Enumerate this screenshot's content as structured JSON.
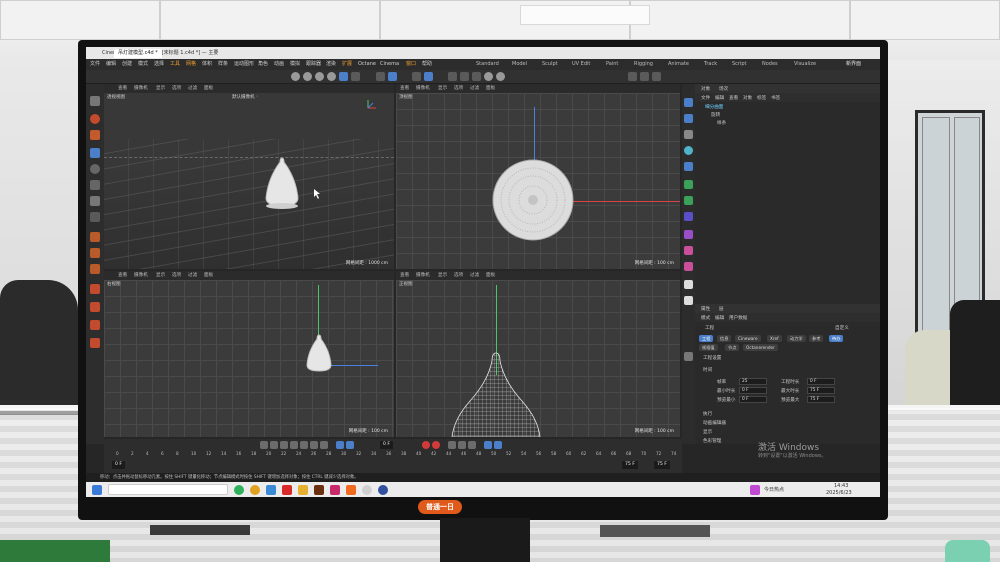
{
  "app": {
    "title": "Cinema 4D 2023.2.2 — [未标题 1.c4d *] — 主要",
    "file_tab": "吊灯建模型.c4d *",
    "menus": [
      "文件",
      "编辑",
      "创建",
      "模式",
      "选择",
      "工具",
      "网格",
      "体积",
      "样条",
      "运动图形",
      "角色",
      "动画",
      "模拟",
      "跟踪器",
      "渲染",
      "扩展",
      "Octane",
      "Cinema",
      "窗口",
      "帮助"
    ],
    "layouts": [
      "Standard",
      "Model",
      "Sculpt",
      "UV Edit",
      "Paint",
      "Rigging",
      "Animate",
      "Track",
      "Script",
      "Nodes",
      "Visualize"
    ],
    "layout_new": "新界面"
  },
  "viewports": [
    {
      "name": "透视视图",
      "camera": "默认摄像机 ◦",
      "scale": "网格间距 : 1000 cm"
    },
    {
      "name": "顶视图",
      "camera": "",
      "scale": "网格间距 : 100 cm"
    },
    {
      "name": "右视图",
      "camera": "",
      "scale": "网格间距 : 100 cm"
    },
    {
      "name": "正视图",
      "camera": "",
      "scale": "网格间距 : 100 cm"
    }
  ],
  "viewport_menu": [
    "查看",
    "摄像机",
    "显示",
    "选项",
    "过滤",
    "面板"
  ],
  "objects_panel": {
    "tabs": [
      "对象",
      "场次"
    ],
    "menu": [
      "文件",
      "编辑",
      "查看",
      "对象",
      "标签",
      "书签"
    ],
    "items": [
      "细分曲面",
      "旋转",
      "样条"
    ]
  },
  "attributes_panel": {
    "tabs": [
      "属性",
      "层"
    ],
    "menu": [
      "模式",
      "编辑",
      "用户数据"
    ],
    "section": "工程",
    "subtabs": [
      "工程",
      "信息",
      "Cineware",
      "Xref",
      "动力学",
      "参考",
      "待办",
      "帧插值",
      "节点",
      "Octanerender"
    ],
    "group": "工程设置",
    "sub_group": "时间",
    "fields": [
      {
        "label": "帧率",
        "value": "25"
      },
      {
        "label": "工程时长",
        "value": "0 F"
      },
      {
        "label": "最小时长",
        "value": "0 F"
      },
      {
        "label": "最大时长",
        "value": "75 F"
      },
      {
        "label": "预览最小",
        "value": "0 F"
      },
      {
        "label": "预览最大",
        "value": "75 F"
      }
    ],
    "collapsed": [
      "执行",
      "动画编辑器",
      "显示",
      "色彩管理"
    ],
    "mode_label": "自定义"
  },
  "timeline": {
    "current_frame": "0 F",
    "start": "0 F",
    "end": "75 F",
    "end2": "75 F",
    "ticks": [
      "0",
      "2",
      "4",
      "6",
      "8",
      "10",
      "12",
      "14",
      "16",
      "18",
      "20",
      "22",
      "24",
      "26",
      "28",
      "30",
      "32",
      "34",
      "36",
      "38",
      "40",
      "42",
      "44",
      "46",
      "48",
      "50",
      "52",
      "54",
      "56",
      "58",
      "60",
      "62",
      "64",
      "66",
      "68",
      "70",
      "72",
      "74"
    ]
  },
  "status": "移动：点击并拖动鼠标移动元素。按住 SHIFT 键量化移动；节点编辑模式时按住 SHIFT 键增加选择对象；按住 CTRL 键减少选择对象。",
  "watermark": {
    "title": "激活 Windows",
    "subtitle": "转到\"设置\"以激活 Windows。"
  },
  "taskbar": {
    "weather": "今日热点",
    "time": "14:43",
    "date": "2025/6/23"
  },
  "monitor_badge": "普通一日",
  "colors": {
    "accent": "#4b7fc9",
    "x_axis": "#d84444",
    "y_axis": "#4ec46a",
    "z_axis": "#4b7fe0",
    "record": "#d33b3b",
    "badge": "#e05a1c"
  }
}
